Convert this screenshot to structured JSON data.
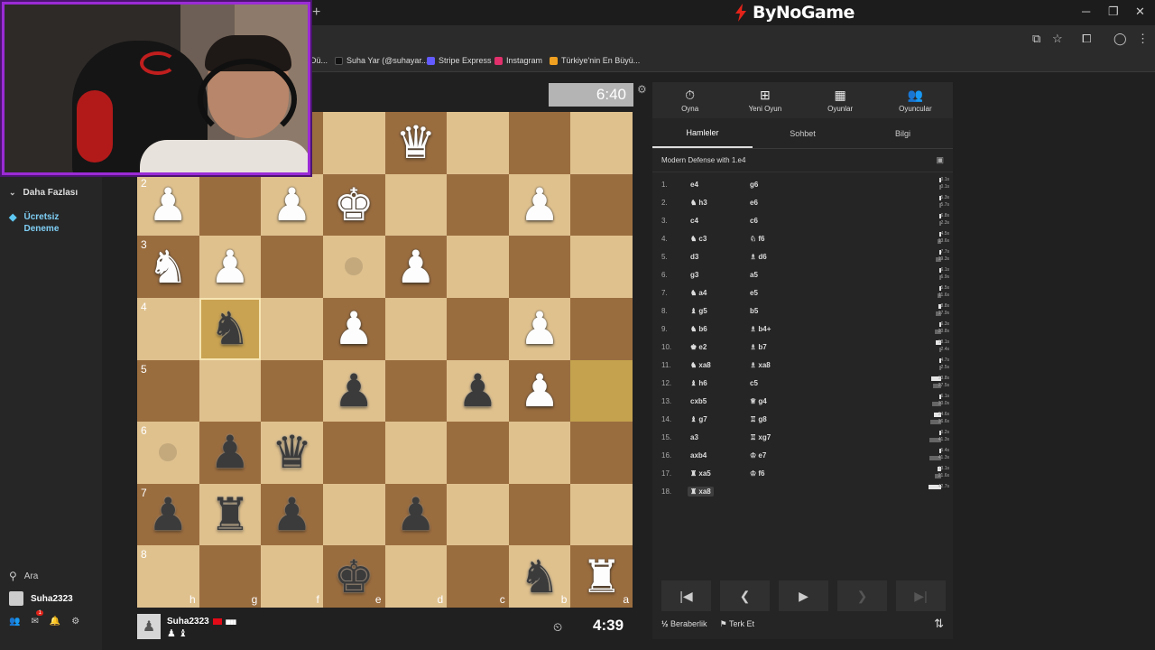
{
  "browser": {
    "new_tab_label": "+",
    "brand": "ByNoGame",
    "bookmarks": [
      {
        "label": "Dü...",
        "color": "#2b2b2b"
      },
      {
        "label": "Suha Yar (@suhayar...",
        "color": "#111111"
      },
      {
        "label": "Stripe Express",
        "color": "#635bff"
      },
      {
        "label": "Instagram",
        "color": "#e1306c"
      },
      {
        "label": "Türkiye'nin En Büyü...",
        "color": "#f0a020"
      }
    ]
  },
  "sidebar": {
    "items": [
      {
        "label": "Daha Fazlası",
        "icon": "chevron-down-icon"
      },
      {
        "label": "Ücretsiz Deneme",
        "icon": "diamond-icon"
      }
    ],
    "search_label": "Ara",
    "user_label": "Suha2323",
    "notification_count": "1"
  },
  "game": {
    "top_clock": "6:40",
    "player": {
      "name": "Suha2323",
      "clock": "4:39",
      "captured": "♟ ♝"
    },
    "files_bottom": [
      "h",
      "g",
      "f",
      "e",
      "d",
      "c",
      "b",
      "a"
    ],
    "ranks": [
      "1",
      "2",
      "3",
      "4",
      "5",
      "6",
      "7",
      "8"
    ],
    "board": [
      [
        "",
        "",
        "",
        "",
        "wQ",
        "",
        "",
        ""
      ],
      [
        "wP",
        "",
        "wP",
        "wK",
        "",
        "",
        "wP",
        ""
      ],
      [
        "wN",
        "wP",
        "",
        "",
        "wP",
        "",
        "",
        ""
      ],
      [
        "",
        "bN",
        "",
        "wP",
        "",
        "",
        "wP",
        ""
      ],
      [
        "",
        "",
        "",
        "bP",
        "",
        "bP",
        "wP",
        ""
      ],
      [
        "",
        "bP",
        "bQ",
        "",
        "",
        "",
        "",
        ""
      ],
      [
        "bP",
        "bR",
        "bP",
        "",
        "bP",
        "",
        "",
        ""
      ],
      [
        "",
        "",
        "",
        "bK",
        "",
        "",
        "bN",
        "wR"
      ]
    ]
  },
  "panel": {
    "nav": [
      {
        "label": "Oyna",
        "icon": "stopwatch-icon",
        "glyph": "⏱"
      },
      {
        "label": "Yeni Oyun",
        "icon": "plus-icon",
        "glyph": "⊞"
      },
      {
        "label": "Oyunlar",
        "icon": "chessboard-icon",
        "glyph": "▦"
      },
      {
        "label": "Oyuncular",
        "icon": "users-icon",
        "glyph": "👥"
      }
    ],
    "subtabs": [
      "Hamleler",
      "Sohbet",
      "Bilgi"
    ],
    "opening": "Modern Defense with 1.e4",
    "moves": [
      {
        "n": "1.",
        "w": "e4",
        "b": "g6",
        "tw": "0.1s",
        "tb": "0.1s"
      },
      {
        "n": "2.",
        "w": "♞ h3",
        "b": "e6",
        "tw": "5.3s",
        "tb": "5.7s"
      },
      {
        "n": "3.",
        "w": "c4",
        "b": "c6",
        "tw": "6.8s",
        "tb": "2.3s"
      },
      {
        "n": "4.",
        "w": "♞ c3",
        "b": "♘ f6",
        "tw": "4.5s",
        "tb": "13.6s"
      },
      {
        "n": "5.",
        "w": "d3",
        "b": "♗ d6",
        "tw": "7.7s",
        "tb": "19.3s"
      },
      {
        "n": "6.",
        "w": "g3",
        "b": "a5",
        "tw": "6.1s",
        "tb": "6.9s"
      },
      {
        "n": "7.",
        "w": "♞ a4",
        "b": "e5",
        "tw": "5.5s",
        "tb": "11.6s"
      },
      {
        "n": "8.",
        "w": "♝ g5",
        "b": "b5",
        "tw": "8.8s",
        "tb": "17.9s"
      },
      {
        "n": "9.",
        "w": "♞ b6",
        "b": "♗ b4+",
        "tw": "6.3s",
        "tb": "20.8s"
      },
      {
        "n": "10.",
        "w": "♚ e2",
        "b": "♗ b7",
        "tw": "18.1s",
        "tb": "2.4s"
      },
      {
        "n": "11.",
        "w": "♞ xa8",
        "b": "♗ xa8",
        "tw": "4.7s",
        "tb": "2.5s"
      },
      {
        "n": "12.",
        "w": "♝ h6",
        "b": "c5",
        "tw": "33.8s",
        "tb": "27.5s"
      },
      {
        "n": "13.",
        "w": "cxb5",
        "b": "♕ g4",
        "tw": "6.1s",
        "tb": "30.0s"
      },
      {
        "n": "14.",
        "w": "♝ g7",
        "b": "♖ g8",
        "tw": "24.6s",
        "tb": "36.6s"
      },
      {
        "n": "15.",
        "w": "a3",
        "b": "♖ xg7",
        "tw": "0.2s",
        "tb": "41.3s"
      },
      {
        "n": "16.",
        "w": "axb4",
        "b": "♔ e7",
        "tw": "5.4s",
        "tb": "41.3s"
      },
      {
        "n": "17.",
        "w": "♜ xa5",
        "b": "♔ f6",
        "tw": "13.1s",
        "tb": "21.6s"
      },
      {
        "n": "18.",
        "w": "♜ xa8",
        "b": "",
        "tw": "42.7s",
        "tb": ""
      }
    ],
    "actions": {
      "draw": "Beraberlik",
      "resign": "Terk Et"
    }
  }
}
